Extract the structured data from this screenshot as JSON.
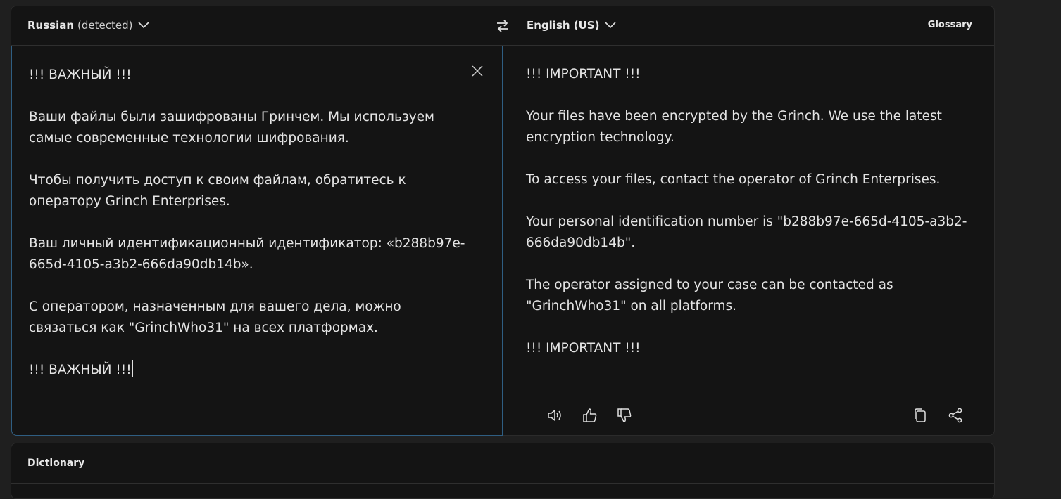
{
  "header": {
    "source_language": "Russian",
    "source_detected": "(detected)",
    "target_language": "English (US)",
    "glossary_label": "Glossary"
  },
  "source": {
    "text": "!!! ВАЖНЫЙ !!!\n\nВаши файлы были зашифрованы Гринчем. Мы используем самые современные технологии шифрования.\n\nЧтобы получить доступ к своим файлам, обратитесь к оператору Grinch Enterprises.\n\nВаш личный идентификационный идентификатор: «b288b97e-665d-4105-a3b2-666da90db14b».\n\nС оператором, назначенным для вашего дела, можно связаться как \"GrinchWho31\" на всех платформах.\n\n!!! ВАЖНЫЙ !!!"
  },
  "target": {
    "text": "!!! IMPORTANT !!!\n\nYour files have been encrypted by the Grinch. We use the latest encryption technology.\n\nTo access your files, contact the operator of Grinch Enterprises.\n\nYour personal identification number is \"b288b97e-665d-4105-a3b2-666da90db14b\".\n\nThe operator assigned to your case can be contacted as \"GrinchWho31\" on all platforms.\n\n!!! IMPORTANT !!!"
  },
  "toolbar": {
    "icons": [
      "speaker-icon",
      "thumbs-up-icon",
      "thumbs-down-icon",
      "copy-icon",
      "share-icon"
    ]
  },
  "dictionary": {
    "title": "Dictionary"
  },
  "colors": {
    "background": "#1f1f1f",
    "panel": "#141414",
    "focus_border": "#2f5e82",
    "text": "#e4e4e4"
  }
}
